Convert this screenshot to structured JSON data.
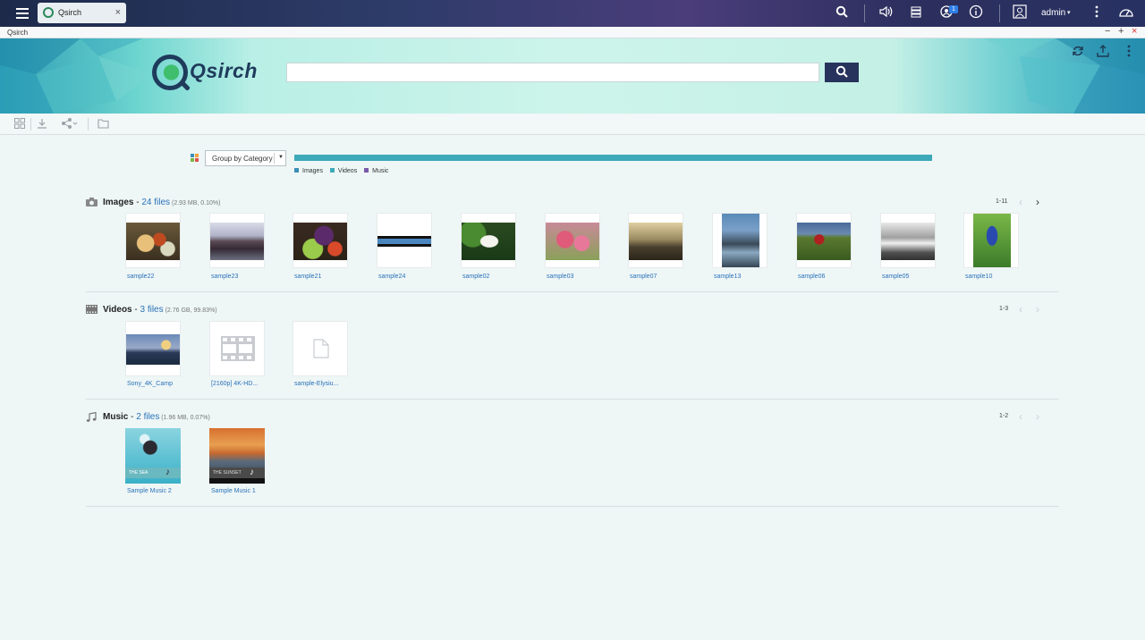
{
  "topbar": {
    "tab_label": "Qsirch",
    "tab_close": "×",
    "notification_count": "1",
    "user_name": "admin",
    "user_caret": "▾"
  },
  "window": {
    "title": "Qsirch",
    "minimize": "−",
    "maximize": "+",
    "close": "×"
  },
  "banner": {
    "logo_text": "Qsirch",
    "search_value": "",
    "search_placeholder": ""
  },
  "group_bar": {
    "select_label": "Group by Category",
    "distribution": {
      "images": 0.1,
      "videos": 99.83,
      "music": 0.07
    },
    "legend": [
      {
        "label": "Images",
        "color": "#3a8fb5"
      },
      {
        "label": "Videos",
        "color": "#3ea9b9"
      },
      {
        "label": "Music",
        "color": "#7a5aa8"
      }
    ]
  },
  "sections": {
    "images": {
      "title": "Images",
      "dash": " - ",
      "count": "24 files",
      "meta": " (2.93 MB, 0.10%)",
      "pager": "1-11",
      "items": [
        "sample22",
        "sample23",
        "sample21",
        "sample24",
        "sample02",
        "sample03",
        "sample07",
        "sample13",
        "sample06",
        "sample05",
        "sample10"
      ]
    },
    "videos": {
      "title": "Videos",
      "dash": " - ",
      "count": "3 files",
      "meta": " (2.76 GB, 99.83%)",
      "pager": "1-3",
      "items": [
        "Sony_4K_Camp",
        "[2160p] 4K-HD...",
        "sample-Elysiu..."
      ]
    },
    "music": {
      "title": "Music",
      "dash": " - ",
      "count": "2 files",
      "meta": " (1.96 MB, 0.07%)",
      "pager": "1-2",
      "items": [
        "Sample Music 2",
        "Sample Music 1"
      ],
      "cover_captions": [
        "THE SEA",
        "THE SUNSET"
      ]
    }
  },
  "colors": {
    "accent": "#27335c",
    "link": "#2a72b8",
    "bar": "#3ea9b9"
  }
}
